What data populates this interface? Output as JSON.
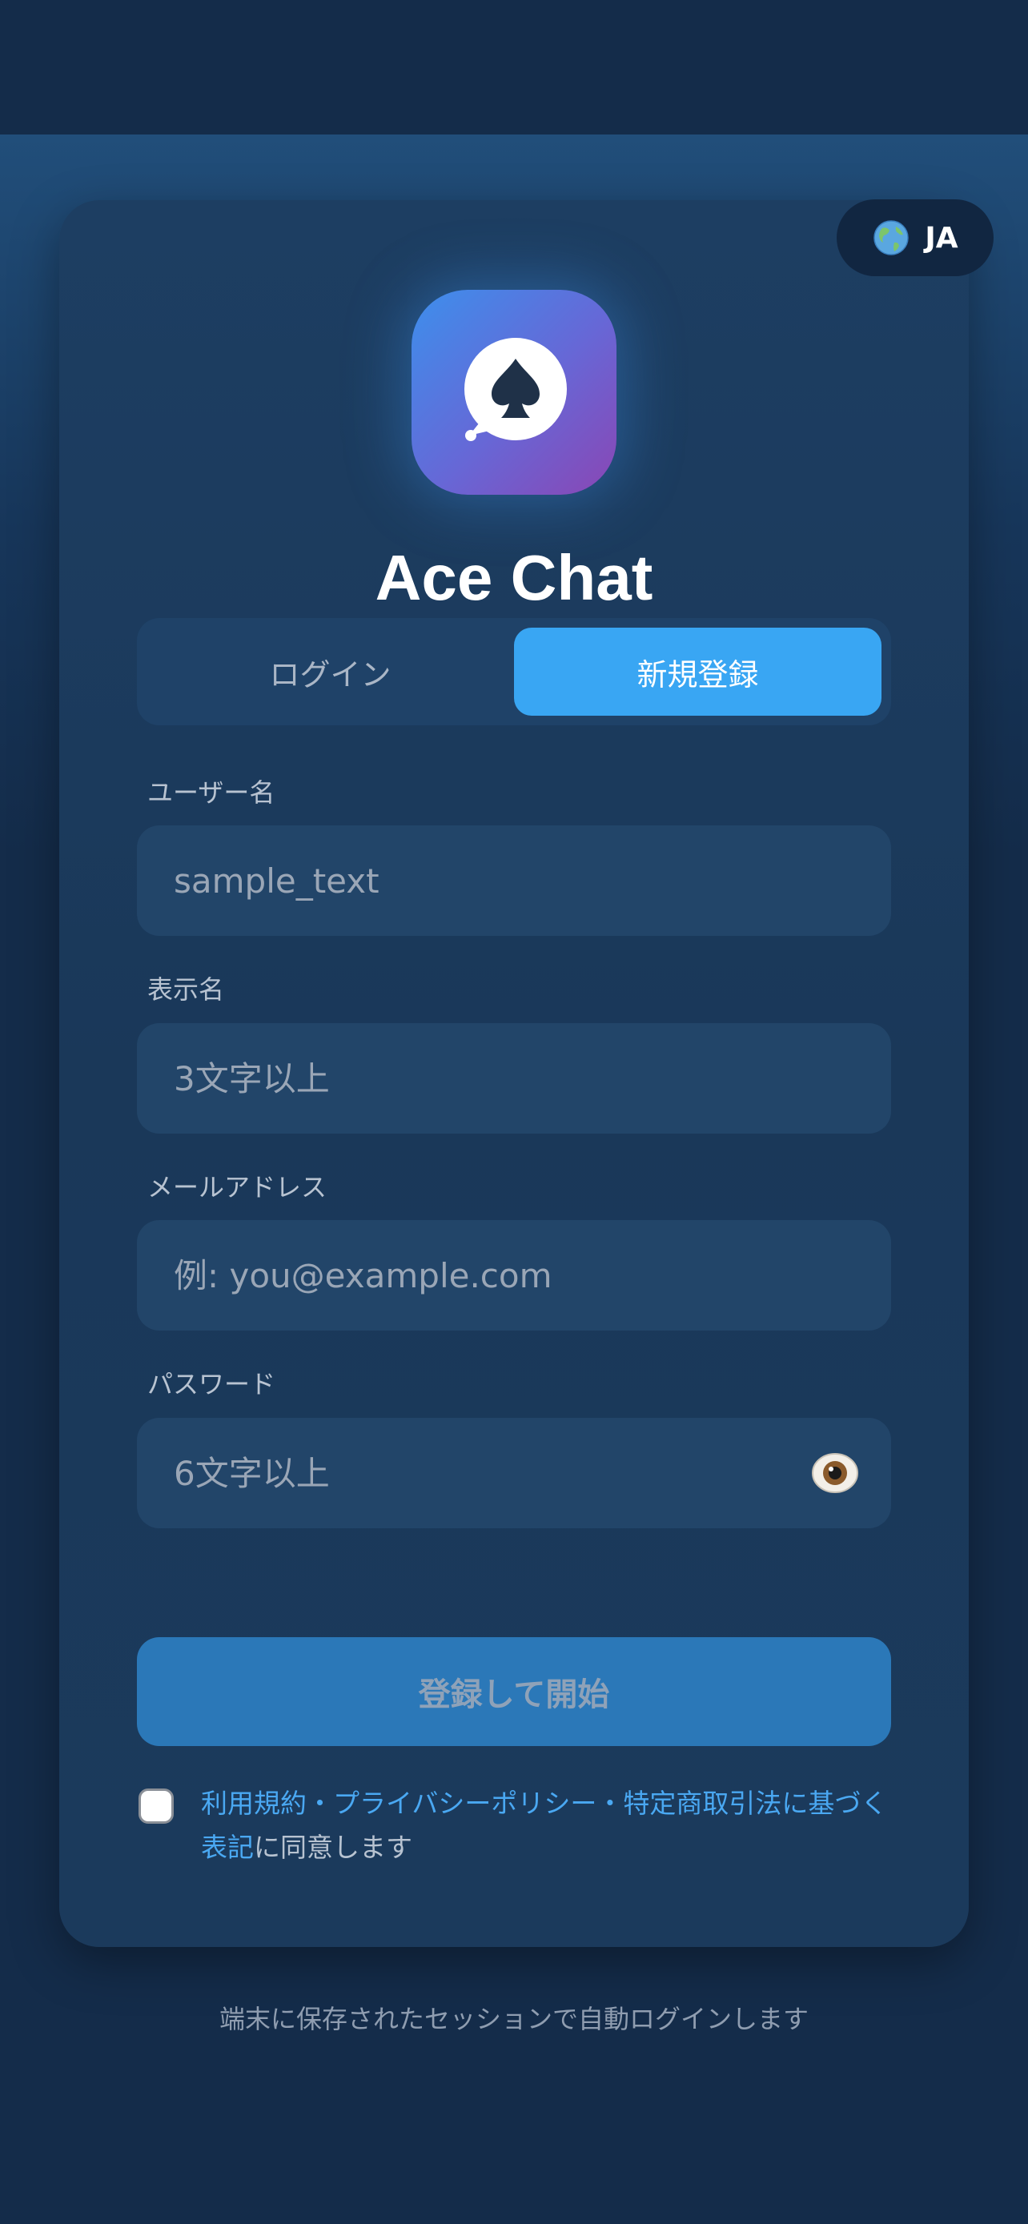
{
  "app": {
    "title": "Ace Chat",
    "logo_icon": "chat-bubble-spade-icon",
    "colors": {
      "background": "#142c4a",
      "card": "#1b3a5c",
      "accent": "#39a6f3",
      "submit": "#2b78b8",
      "link": "#4aa8f2"
    }
  },
  "language": {
    "icon": "globe-icon",
    "code": "JA"
  },
  "tabs": {
    "login": "ログイン",
    "signup": "新規登録",
    "active": "signup"
  },
  "form": {
    "username": {
      "label": "ユーザー名",
      "value": "",
      "placeholder": "sample_text"
    },
    "display_name": {
      "label": "表示名",
      "value": "",
      "placeholder": "3文字以上"
    },
    "email": {
      "label": "メールアドレス",
      "value": "",
      "placeholder": "例: you@example.com"
    },
    "password": {
      "label": "パスワード",
      "value": "",
      "placeholder": "6文字以上",
      "toggle_icon": "eye-icon"
    },
    "submit_label": "登録して開始"
  },
  "agreement": {
    "checked": false,
    "link_terms": "利用規約",
    "sep1": "・",
    "link_privacy": "プライバシーポリシー",
    "sep2": "・",
    "link_commerce": "特定商取引法に基づく表記",
    "suffix": "に同意します"
  },
  "footer": {
    "note": "端末に保存されたセッションで自動ログインします"
  }
}
